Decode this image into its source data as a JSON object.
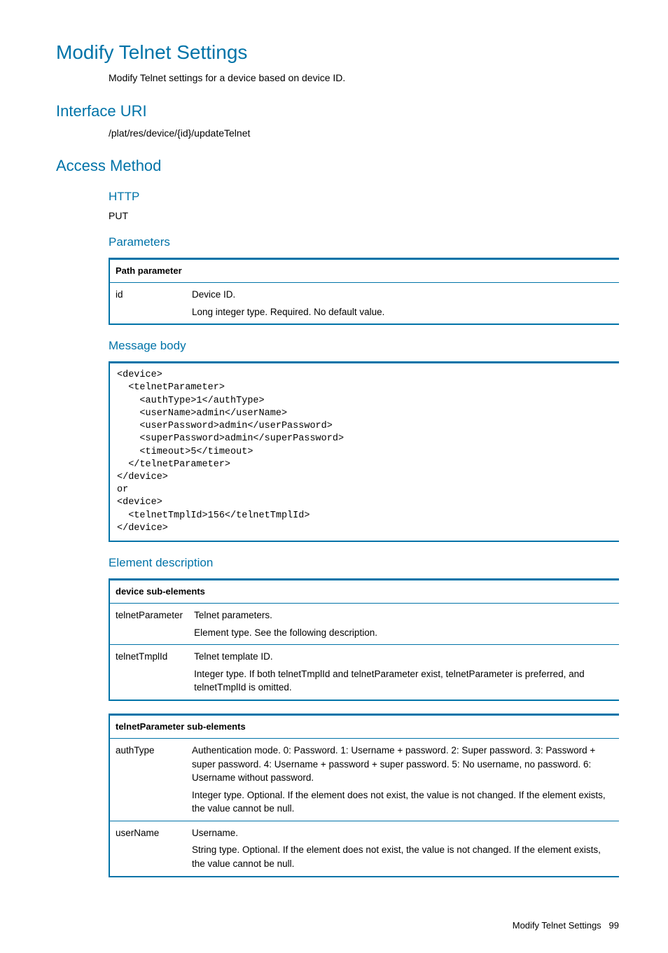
{
  "title": "Modify Telnet Settings",
  "description": "Modify Telnet settings for a device based on device ID.",
  "interface_uri_heading": "Interface URI",
  "interface_uri": "/plat/res/device/{id}/updateTelnet",
  "access_method_heading": "Access Method",
  "http_heading": "HTTP",
  "http_method": "PUT",
  "parameters_heading": "Parameters",
  "path_param_header": "Path parameter",
  "path_params": {
    "id": {
      "name": "id",
      "desc1": "Device ID.",
      "desc2": "Long integer type. Required. No default value."
    }
  },
  "message_body_heading": "Message body",
  "message_body_code": "<device>\n  <telnetParameter>\n    <authType>1</authType>\n    <userName>admin</userName>\n    <userPassword>admin</userPassword>\n    <superPassword>admin</superPassword>\n    <timeout>5</timeout>\n  </telnetParameter>\n</device>\nor\n<device>\n  <telnetTmplId>156</telnetTmplId>\n</device>",
  "element_desc_heading": "Element description",
  "device_sub_header": "device sub-elements",
  "device_sub": {
    "telnetParameter": {
      "name": "telnetParameter",
      "desc1": "Telnet parameters.",
      "desc2": "Element type. See the following description."
    },
    "telnetTmplId": {
      "name": "telnetTmplId",
      "desc1": "Telnet template ID.",
      "desc2": "Integer type. If both telnetTmplId and telnetParameter exist, telnetParameter is preferred, and telnetTmplId is omitted."
    }
  },
  "telnet_param_header": "telnetParameter sub-elements",
  "telnet_params": {
    "authType": {
      "name": "authType",
      "desc1": "Authentication mode. 0: Password. 1: Username + password. 2: Super password. 3: Password + super password. 4: Username + password + super password. 5: No username, no password. 6: Username without password.",
      "desc2": "Integer type. Optional. If the element does not exist, the value is not changed. If the element exists, the value cannot be null."
    },
    "userName": {
      "name": "userName",
      "desc1": "Username.",
      "desc2": "String type. Optional. If the element does not exist, the value is not changed. If the element exists, the value cannot be null."
    }
  },
  "footer_title": "Modify Telnet Settings",
  "footer_page": "99"
}
